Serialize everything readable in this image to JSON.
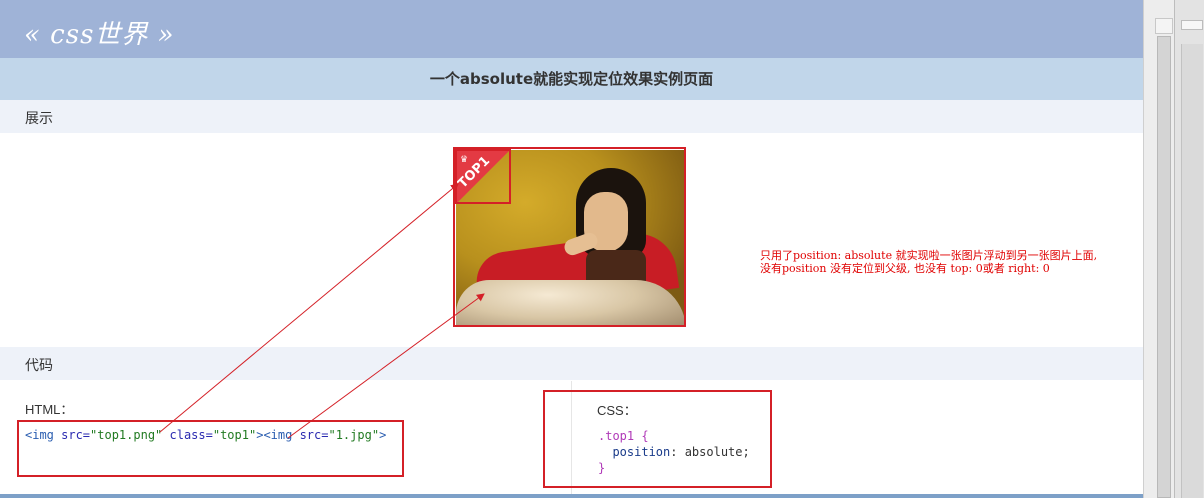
{
  "header": {
    "logo": "« css世界 »",
    "title": "一个absolute就能实现定位效果实例页面"
  },
  "sections": {
    "demo": "展示",
    "code": "代码"
  },
  "demo": {
    "badge_text": "TOP1",
    "note_line1": "只用了position: absolute 就实现啦一张图片浮动到另一张图片上面,",
    "note_line2": "没有position 没有定位到父级, 也没有 top: 0或者 right: 0"
  },
  "code": {
    "html_label": "HTML：",
    "html_snippet": {
      "p1": "<img ",
      "p2": "src=",
      "p3": "\"top1.png\"",
      "p4": " class=",
      "p5": "\"top1\"",
      "p6": "><img ",
      "p7": "src=",
      "p8": "\"1.jpg\"",
      "p9": ">"
    },
    "css_label": "CSS：",
    "css_selector": ".top1 {",
    "css_property": "position",
    "css_value": ": absolute;",
    "css_close": "}"
  },
  "colors": {
    "header_bg": "#9fb3d7",
    "title_bg": "#c1d6ea",
    "section_bg": "#eef2f9",
    "annotation_red": "#d42027"
  }
}
